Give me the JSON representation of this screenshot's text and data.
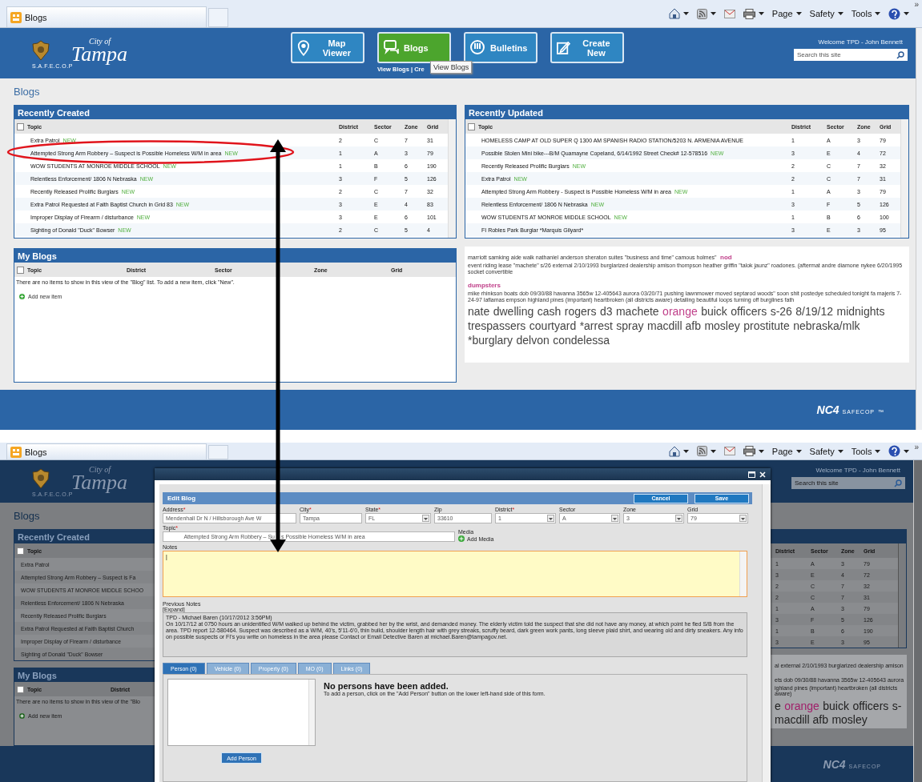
{
  "top_screen": {
    "browser": {
      "tab_title": "Blogs",
      "toolbar": [
        {
          "kind": "home"
        },
        {
          "kind": "feed"
        },
        {
          "kind": "mail"
        },
        {
          "kind": "print"
        },
        {
          "kind": "menu",
          "label": "Page"
        },
        {
          "kind": "menu",
          "label": "Safety"
        },
        {
          "kind": "menu",
          "label": "Tools"
        },
        {
          "kind": "help"
        }
      ],
      "overflow": "»"
    },
    "header": {
      "logo_top": "City of",
      "logo_main": "Tampa",
      "logo_tag": "S.A.F.E.C.O.P",
      "nav": [
        {
          "label": "Map Viewer",
          "kind": "pin",
          "selected": false
        },
        {
          "label": "Blogs",
          "kind": "chat",
          "selected": true
        },
        {
          "label": "Bulletins",
          "kind": "alert",
          "selected": false
        },
        {
          "label": "Create New",
          "kind": "edit",
          "selected": false
        }
      ],
      "sublinks": "View Blogs | Cre",
      "tooltip": "View Blogs",
      "welcome": "Welcome  TPD - John Bennett",
      "search_placeholder": "Search this site"
    },
    "page_title": "Blogs",
    "recently_created": {
      "title": "Recently Created",
      "all_checked": false,
      "columns": [
        "Topic",
        "District",
        "Sector",
        "Zone",
        "Grid"
      ],
      "rows": [
        {
          "cells": [
            "Extra Patrol",
            "2",
            "C",
            "7",
            "31"
          ],
          "badge": "NEW"
        },
        {
          "cells": [
            "Attempted Strong Arm Robbery – Suspect is Possible Homeless W/M in area",
            "1",
            "A",
            "3",
            "79"
          ],
          "badge": "NEW"
        },
        {
          "cells": [
            "WOW STUDENTS AT MONROE MIDDLE SCHOOL",
            "1",
            "B",
            "6",
            "190"
          ],
          "badge": "NEW"
        },
        {
          "cells": [
            "Relentless Enforcement/ 1806 N Nebraska",
            "3",
            "F",
            "5",
            "126"
          ],
          "badge": "NEW"
        },
        {
          "cells": [
            "Recently Released Prolific Burglars",
            "2",
            "C",
            "7",
            "32"
          ],
          "badge": "NEW"
        },
        {
          "cells": [
            "Extra Patrol Requested at Faith Baptist Church in Grid 83",
            "3",
            "E",
            "4",
            "83"
          ],
          "badge": "NEW"
        },
        {
          "cells": [
            "Improper Display of Firearm / disturbance",
            "3",
            "E",
            "6",
            "101"
          ],
          "badge": "NEW"
        },
        {
          "cells": [
            "Sighting of Donald \"Duck\" Bowser",
            "2",
            "C",
            "5",
            "4"
          ],
          "badge": "NEW"
        }
      ]
    },
    "recently_updated": {
      "title": "Recently Updated",
      "all_checked": false,
      "columns": [
        "Topic",
        "District",
        "Sector",
        "Zone",
        "Grid"
      ],
      "rows": [
        {
          "cells": [
            "HOMELESS CAMP AT OLD SUPER Q 1300 AM SPANISH RADIO STATION/5203 N. ARMENIA AVENUE",
            "1",
            "A",
            "3",
            "79"
          ]
        },
        {
          "cells": [
            "Possible Stolen Mini bike---B/M Quamayne Copeland, 6/14/1992 Street Check# 12-578516",
            "3",
            "E",
            "4",
            "72"
          ],
          "badge": "NEW"
        },
        {
          "cells": [
            "Recently Released Prolific Burglars",
            "2",
            "C",
            "7",
            "32"
          ],
          "badge": "NEW"
        },
        {
          "cells": [
            "Extra Patrol",
            "2",
            "C",
            "7",
            "31"
          ],
          "badge": "NEW"
        },
        {
          "cells": [
            "Attempted Strong Arm Robbery - Suspect is Possible Homeless W/M in area",
            "1",
            "A",
            "3",
            "79"
          ],
          "badge": "NEW"
        },
        {
          "cells": [
            "Relentless Enforcement/ 1806 N Nebraska",
            "3",
            "F",
            "5",
            "126"
          ],
          "badge": "NEW"
        },
        {
          "cells": [
            "WOW STUDENTS AT MONROE MIDDLE SCHOOL",
            "1",
            "B",
            "6",
            "100"
          ],
          "badge": "NEW"
        },
        {
          "cells": [
            "FI Robles Park Burglar *Marquis Gilyard*",
            "3",
            "E",
            "3",
            "95"
          ]
        }
      ]
    },
    "my_blogs": {
      "title": "My Blogs",
      "all_checked": false,
      "columns": [
        "Topic",
        "District",
        "Sector",
        "Zone",
        "Grid"
      ],
      "empty_message": "There are no items to show in this view of the \"Blog\" list. To add a new item, click \"New\".",
      "add_link": "Add new item"
    },
    "tag_cloud": [
      {
        "text": "marriott samking aide walk nathaniel anderson sheraton suites \"business and time\" camous holmes\"",
        "kind": "small"
      },
      {
        "text": "nod",
        "kind": "small",
        "color": "#c0408a"
      },
      {
        "text": "event riding lease \"machete\" s/26 external 2/10/1993 burglarized dealership amison thompson heather griffin \"talok jaunz\" roadones. (aftermat andre diamone nykee 6/20/1995 socket convertible",
        "kind": "small"
      },
      {
        "text": "dumpsters",
        "kind": "small",
        "color": "#c0408a"
      },
      {
        "text": "mike rhinkson boats dob 09/30/88 havanna 3565w 12-405643 aurora 03/20/71 pushing lawnmower moved septarod woods\" soon shit postedye scheduled tonight fa majeris 7-24-97 laflamas empson highland pines (important) heartbroken (all districts aware) detailing beautiful loops turning off burglines fath",
        "kind": "small"
      },
      {
        "text": "nate",
        "kind": "large"
      },
      {
        "text": "dwelling",
        "kind": "large"
      },
      {
        "text": "cash",
        "kind": "large"
      },
      {
        "text": "rogers",
        "kind": "large"
      },
      {
        "text": "d3",
        "kind": "large"
      },
      {
        "text": "machete",
        "kind": "large"
      },
      {
        "text": "orange",
        "kind": "large",
        "color": "#c0408a"
      },
      {
        "text": "buick",
        "kind": "large"
      },
      {
        "text": "officers",
        "kind": "large"
      },
      {
        "text": "s-26",
        "kind": "large"
      },
      {
        "text": "8/19/12",
        "kind": "large"
      },
      {
        "text": "midnights",
        "kind": "large"
      },
      {
        "text": "trespassers",
        "kind": "large"
      },
      {
        "text": "courtyard",
        "kind": "large"
      },
      {
        "text": "*arrest",
        "kind": "large"
      },
      {
        "text": "spray",
        "kind": "large"
      },
      {
        "text": "macdill afb",
        "kind": "large"
      },
      {
        "text": "mosley",
        "kind": "large"
      },
      {
        "text": "prostitute",
        "kind": "large"
      },
      {
        "text": "nebraska/mlk",
        "kind": "large"
      },
      {
        "text": "*burglary",
        "kind": "large"
      },
      {
        "text": "delvon",
        "kind": "large"
      },
      {
        "text": "condelessa",
        "kind": "large"
      }
    ],
    "footer": {
      "logo": "NC4",
      "tag": "SAFECOP",
      "mark": "™"
    }
  },
  "bottom_screen": {
    "browser": {
      "tab_title": "Blogs",
      "toolbar": [
        {
          "kind": "home"
        },
        {
          "kind": "feed"
        },
        {
          "kind": "mail"
        },
        {
          "kind": "print"
        },
        {
          "kind": "menu",
          "label": "Page"
        },
        {
          "kind": "menu",
          "label": "Safety"
        },
        {
          "kind": "menu",
          "label": "Tools"
        },
        {
          "kind": "help"
        }
      ],
      "overflow": "»"
    },
    "header": {
      "logo_top": "City of",
      "logo_main": "Tampa",
      "logo_tag": "S.A.F.E.C.O.P",
      "welcome": "Welcome  TPD - John Bennett",
      "search_placeholder": "Search this site"
    },
    "page_title": "Blogs",
    "left_panel": {
      "title": "Recently Created",
      "all_checked": false,
      "column": "Topic",
      "rows": [
        "Extra Patrol",
        "Attempted Strong Arm Robbery – Suspect is Fa",
        "WOW STUDENTS AT MONROE MIDDLE SCHOO",
        "Relentless Enforcement/ 1806 N Nebraska",
        "Recently Released Prolific Burglars",
        "Extra Patrol Requested at Faith Baptist Church",
        "Improper Display of Firearm / disturbance",
        "Sighting of Donald \"Duck\" Bowser"
      ]
    },
    "my_blogs": {
      "title": "My Blogs",
      "all_checked": false,
      "columns": [
        "Topic",
        "District"
      ],
      "empty_message": "There are no items to show in this view of the \"Blo",
      "add_link": "Add new item"
    },
    "right_panel": {
      "columns": [
        "District",
        "Sector",
        "Zone",
        "Grid"
      ],
      "rows": [
        [
          "1",
          "A",
          "3",
          "79"
        ],
        [
          "3",
          "E",
          "4",
          "72"
        ],
        [
          "2",
          "C",
          "7",
          "32"
        ],
        [
          "2",
          "C",
          "7",
          "31"
        ],
        [
          "1",
          "A",
          "3",
          "79"
        ],
        [
          "3",
          "F",
          "5",
          "126"
        ],
        [
          "1",
          "B",
          "6",
          "190"
        ],
        [
          "3",
          "E",
          "3",
          "95"
        ]
      ]
    },
    "tag_cloud": [
      {
        "text": "al external 2/10/1993 burglarized dealership amison",
        "kind": "small"
      },
      {
        "text": "ets dob 09/30/88 havanna 3565w 12-405643 aurora",
        "kind": "small"
      },
      {
        "text": "ighland pines (important) heartbroken (all districts aware)",
        "kind": "small"
      },
      {
        "text": "e",
        "kind": "large"
      },
      {
        "text": "orange",
        "kind": "large",
        "color": "#a0206a"
      },
      {
        "text": "buick",
        "kind": "large"
      },
      {
        "text": "officers",
        "kind": "large"
      },
      {
        "text": "s-",
        "kind": "large"
      },
      {
        "text": "macdill afb",
        "kind": "large"
      },
      {
        "text": "mosley",
        "kind": "large"
      }
    ],
    "footer": {
      "logo": "NC4",
      "tag": "SAFECOP"
    },
    "dialog": {
      "title": "Edit Blog",
      "buttons": [
        "Cancel",
        "Save"
      ],
      "fields": [
        {
          "label": "Address",
          "required_mark": "*",
          "value": "Mendenhall Dr N / Hillsborough Ave W",
          "kind": "text"
        },
        {
          "label": "City",
          "required_mark": "*",
          "value": "Tampa",
          "kind": "text"
        },
        {
          "label": "State",
          "required_mark": "*",
          "value": "FL",
          "kind": "select"
        },
        {
          "label": "Zip",
          "value": "33610",
          "kind": "text"
        },
        {
          "label": "District",
          "required_mark": "*",
          "value": "1",
          "kind": "select"
        },
        {
          "label": "Sector",
          "value": "A",
          "kind": "select"
        },
        {
          "label": "Zone",
          "value": "3",
          "kind": "select"
        },
        {
          "label": "Grid",
          "value": "79",
          "kind": "select"
        }
      ],
      "topic": {
        "label": "Topic",
        "required_mark": "*",
        "value": [
          "Attempted Strong Arm Robbery – Su",
          "s Possible Homeless W/M in area"
        ]
      },
      "media": {
        "label": "Media",
        "link": "Add Media"
      },
      "notes": {
        "label": "Notes",
        "value": "|"
      },
      "previous_notes": {
        "label": "Previous Notes",
        "expand": "[Expand]",
        "author": "TPD - Michael Baren (10/17/2012 3:56PM)",
        "text": "On 10/17/12 at 0750 hours an unidentified W/M walked up behind the victim, grabbed her by the wrist, and demanded money. The elderly victim told the suspect that she did not have any money, at which point he fled S/B from the area. TPD report 12-580464. Suspect was described as a W/M, 40's, 5'11-6'0, thin build, shoulder length hair with grey streaks, scruffy beard, dark green work pants, long sleeve plaid shirt, and wearing old and dirty sneakers. Any info on possible suspects or FI's you write on homeless in the area please Contact or Email Detective Baren at michael.Baren@tampagov.net."
      },
      "tabs": [
        {
          "label": "Person (0)",
          "selected": true
        },
        {
          "label": "Vehicle (0)",
          "selected": false
        },
        {
          "label": "Property (0)",
          "selected": false
        },
        {
          "label": "MO (0)",
          "selected": false
        },
        {
          "label": "Links (0)",
          "selected": false
        }
      ],
      "empty_title": "No persons have been added.",
      "empty_hint": "To add a person, click on the \"Add Person\" button on the lower left-hand side of this form.",
      "add_button": "Add Person"
    }
  },
  "annotations": [
    {
      "kind": "ellipse"
    },
    {
      "kind": "double-arrow"
    }
  ]
}
